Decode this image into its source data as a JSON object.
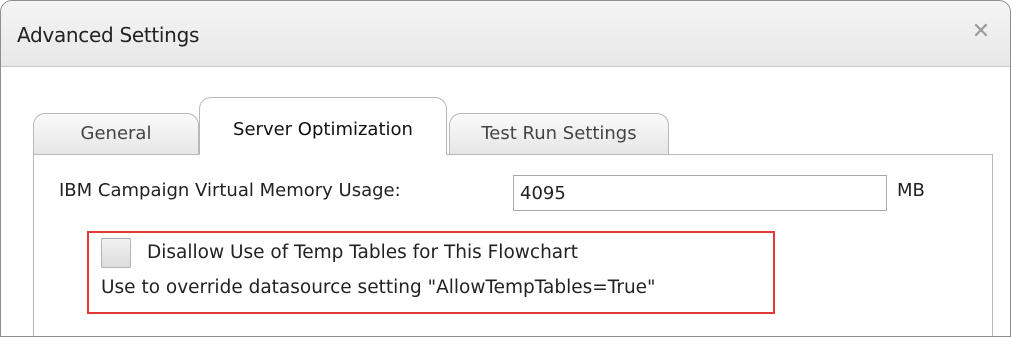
{
  "dialog": {
    "title": "Advanced Settings",
    "close_glyph": "✕"
  },
  "tabs": [
    {
      "label": "General"
    },
    {
      "label": "Server Optimization"
    },
    {
      "label": "Test Run Settings"
    }
  ],
  "active_tab": "Server Optimization",
  "memory": {
    "label": "IBM Campaign Virtual Memory Usage:",
    "value": "4095",
    "unit": "MB"
  },
  "temp_tables": {
    "checked": false,
    "label": "Disallow Use of Temp Tables for This Flowchart",
    "hint": "Use to override datasource setting \"AllowTempTables=True\""
  },
  "colors": {
    "highlight_border": "#e53935"
  }
}
